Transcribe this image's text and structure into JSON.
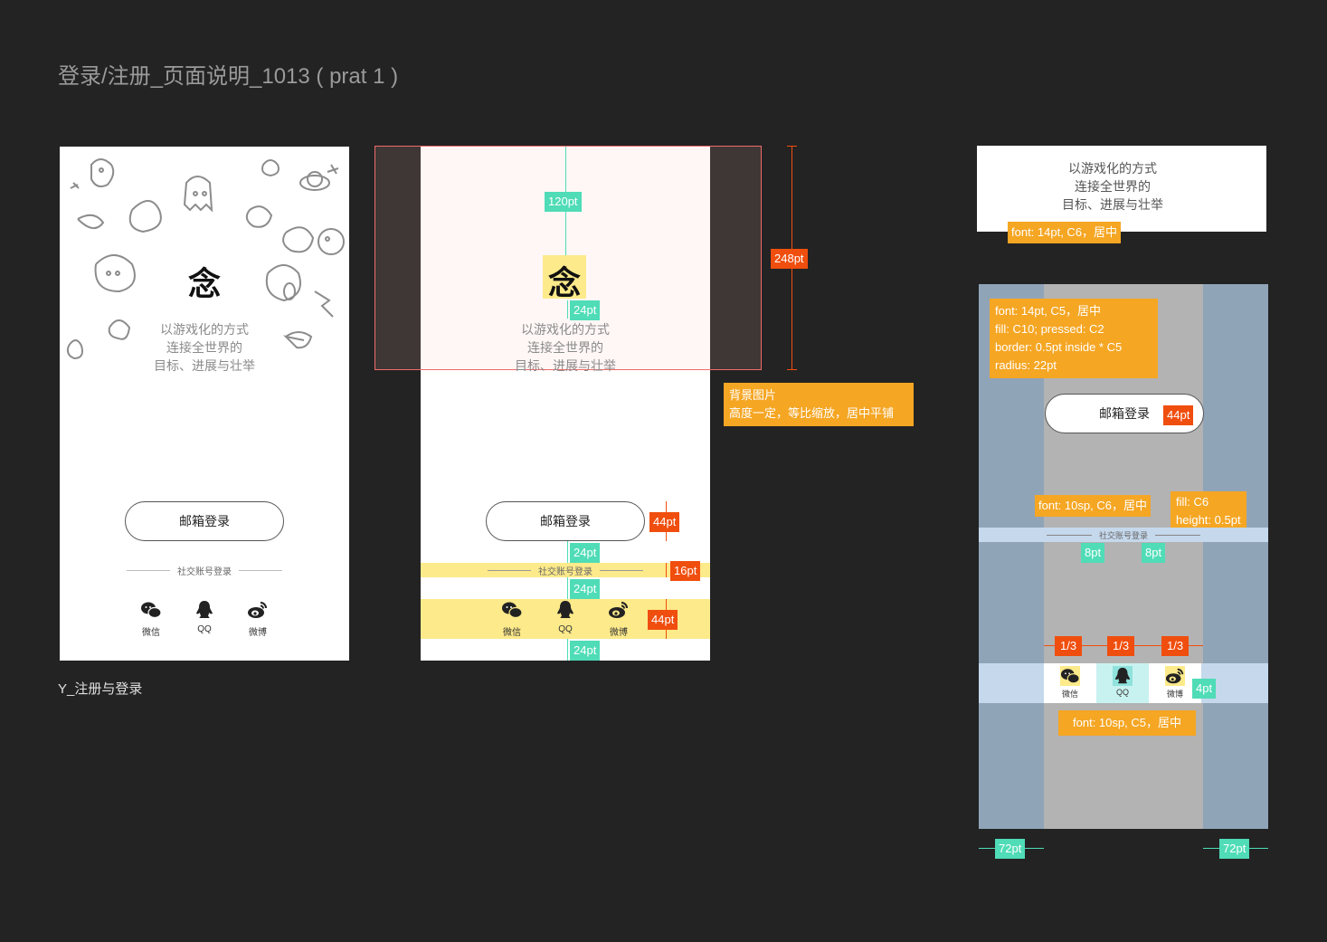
{
  "page_title": "登录/注册_页面说明_1013 ( prat 1 )",
  "screen_caption": "Y_注册与登录",
  "app": {
    "logo": "念",
    "slogan": [
      "以游戏化的方式",
      "连接全世界的",
      "目标、进展与壮举"
    ],
    "email_login": "邮箱登录",
    "social_divider": "社交账号登录",
    "social": [
      {
        "label": "微信",
        "icon": "wechat-icon"
      },
      {
        "label": "QQ",
        "icon": "qq-icon"
      },
      {
        "label": "微博",
        "icon": "weibo-icon"
      }
    ]
  },
  "annotations": {
    "top_spacing": "120pt",
    "logo_gap": "24pt",
    "bg_height": "248pt",
    "button_height": "44pt",
    "gap_after_button": "24pt",
    "divider_height": "16pt",
    "gap_after_divider": "24pt",
    "social_height": "44pt",
    "bottom_gap": "24pt",
    "bg_note_title": "背景图片",
    "bg_note_body": "高度一定，等比缩放，居中平铺",
    "slogan_font": "font: 14pt, C6，居中",
    "button_spec": [
      "font: 14pt, C5，居中",
      "fill: C10; pressed: C2",
      "border: 0.5pt inside * C5",
      "radius: 22pt"
    ],
    "button_height_right": "44pt",
    "divider_font": "font: 10sp, C6，居中",
    "divider_line": [
      "fill: C6",
      "height: 0.5pt"
    ],
    "divider_pad_left": "8pt",
    "divider_pad_right": "8pt",
    "thirds": [
      "1/3",
      "1/3",
      "1/3"
    ],
    "icon_gap": "4pt",
    "social_font": "font: 10sp, C5，居中",
    "margin_left": "72pt",
    "margin_right": "72pt"
  },
  "colors": {
    "background": "#232323",
    "green_tag": "#4fdcb7",
    "red_tag": "#f04e0e",
    "orange_tag": "#f5a623",
    "highlight_yellow": "#fdea8a",
    "margin_blue": "#90a4b8",
    "content_gray": "#b3b3b3"
  }
}
